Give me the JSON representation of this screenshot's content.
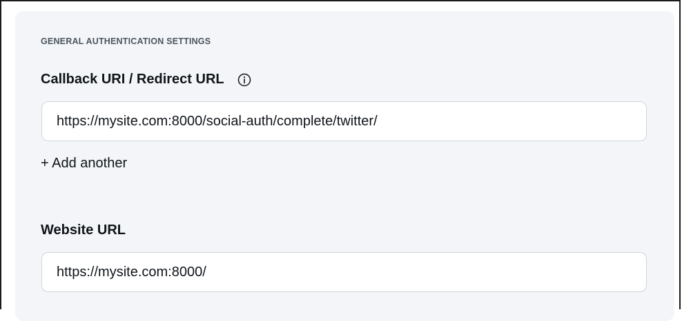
{
  "section": {
    "title": "GENERAL AUTHENTICATION SETTINGS"
  },
  "callback": {
    "label": "Callback URI / Redirect URL",
    "info_icon": "info-circle-icon",
    "value": "https://mysite.com:8000/social-auth/complete/twitter/",
    "add_another_label": "+ Add another"
  },
  "website": {
    "label": "Website URL",
    "value": "https://mysite.com:8000/"
  },
  "colors": {
    "panel_background": "#f3f5f8",
    "input_border": "#cfd6dc",
    "text": "#0f1419",
    "section_title": "#4a5560"
  }
}
